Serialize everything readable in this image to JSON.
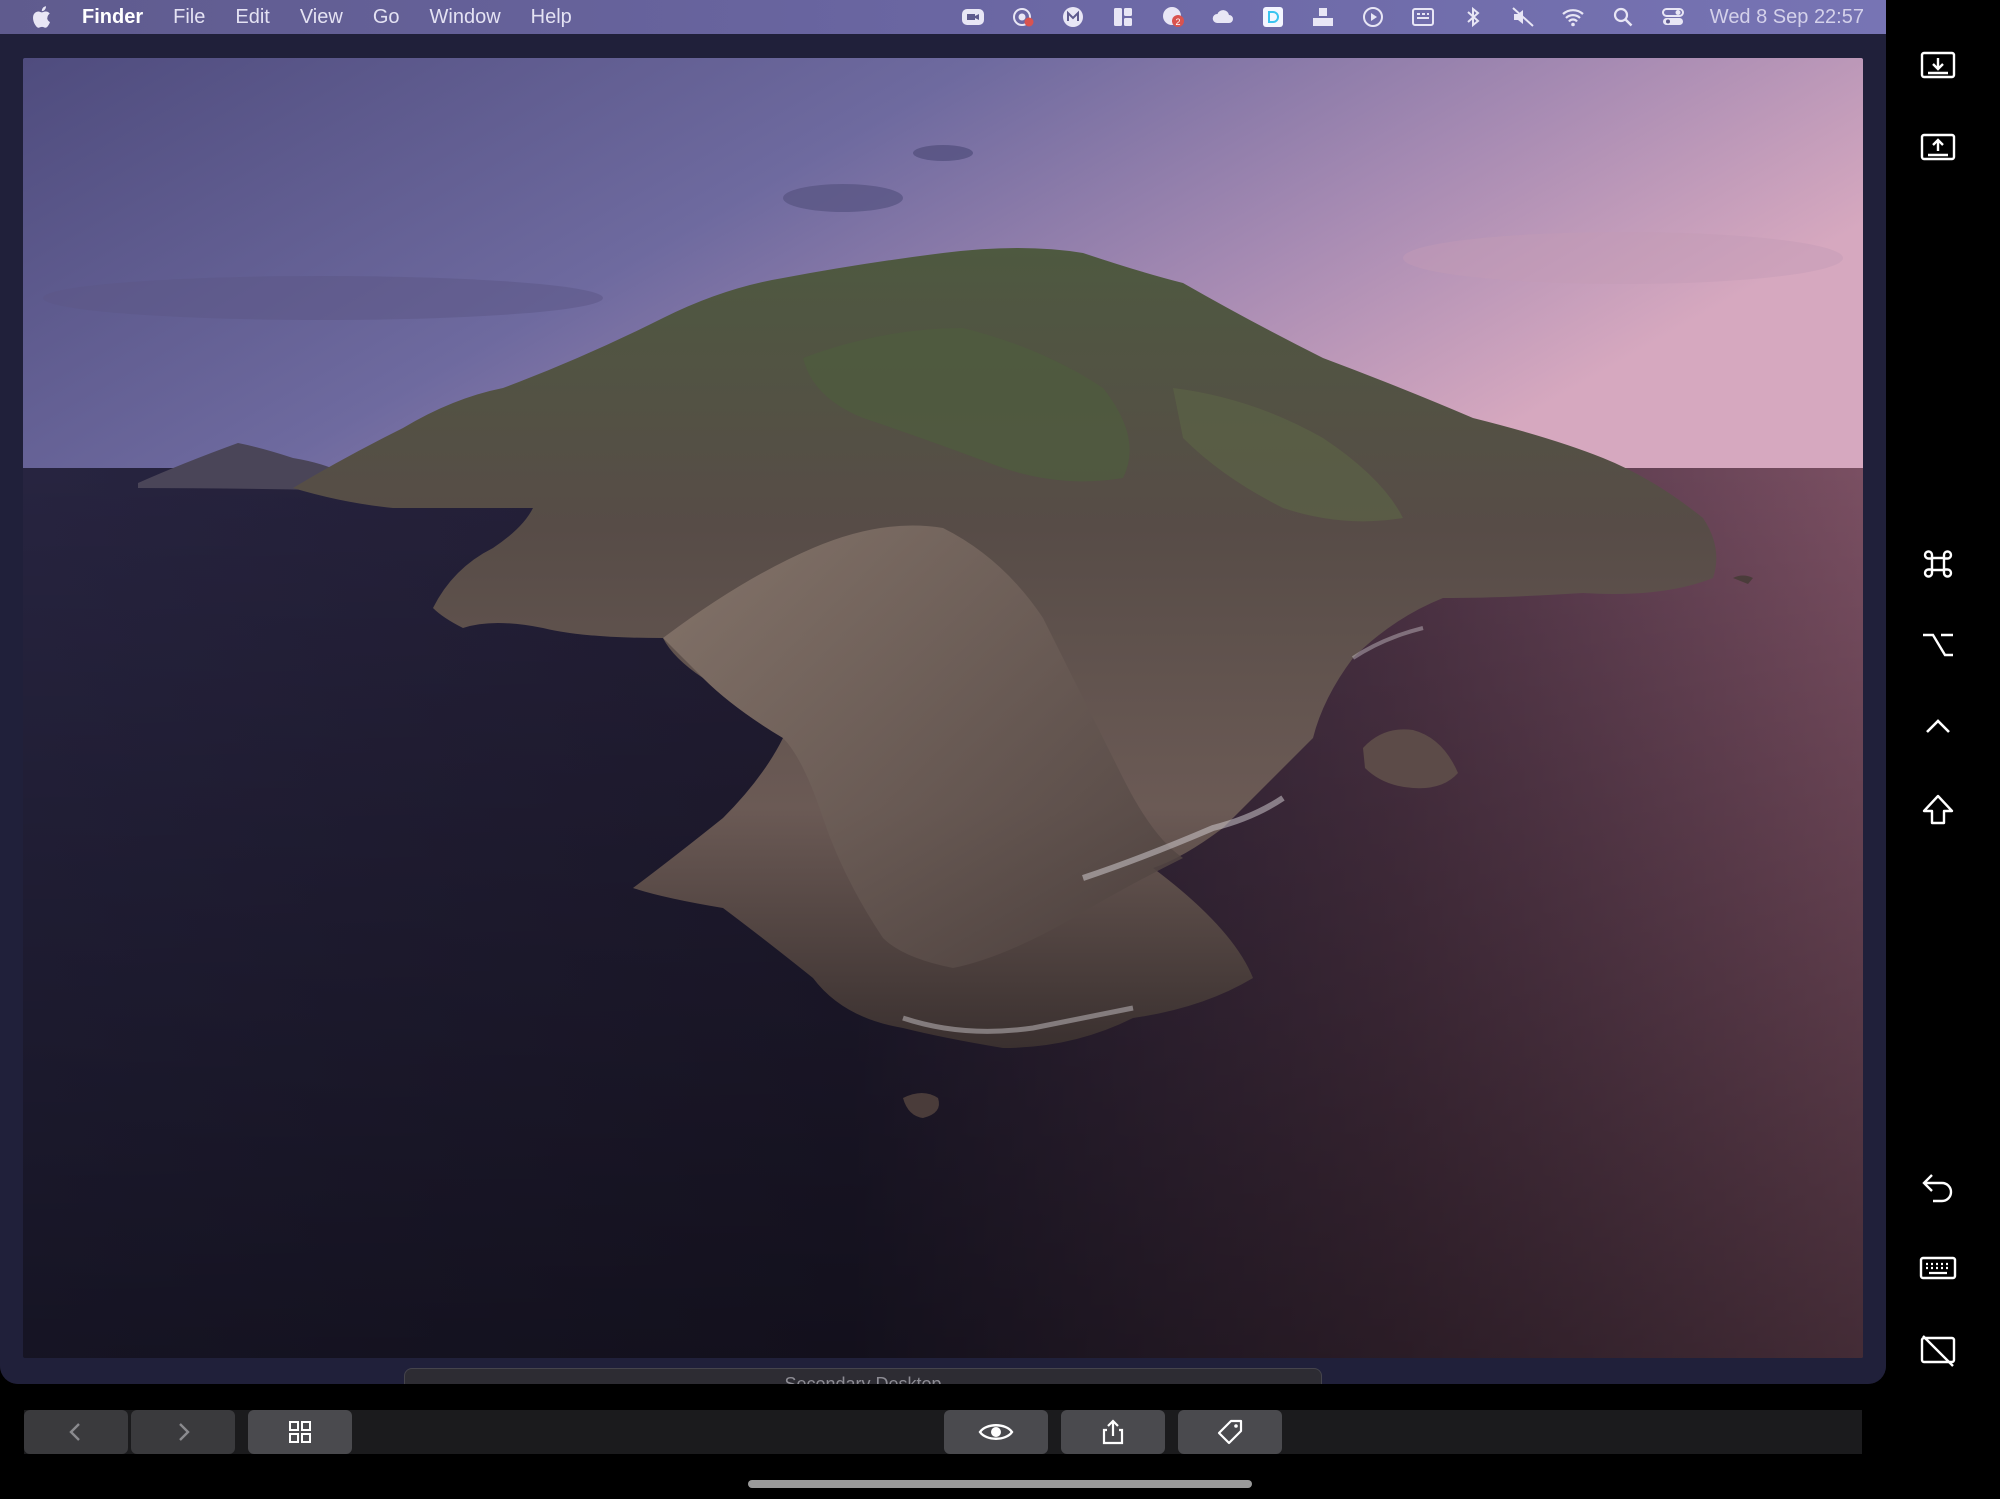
{
  "menubar": {
    "app_name": "Finder",
    "items": [
      "File",
      "Edit",
      "View",
      "Go",
      "Window",
      "Help"
    ],
    "clock": "Wed 8 Sep  22:57",
    "status_icons": [
      "zoom-icon",
      "screen-record-icon",
      "m-app-icon",
      "layout-icon",
      "notification-badge-icon",
      "cloud-icon",
      "d-app-icon",
      "dock-share-icon",
      "play-icon",
      "keyboard-icon",
      "bluetooth-icon",
      "mute-icon",
      "wifi-icon",
      "search-icon",
      "control-center-icon"
    ],
    "badge_count": "2"
  },
  "space": {
    "label": "Secondary Desktop"
  },
  "sidebar": {
    "buttons": [
      "download-screen-icon",
      "upload-screen-icon",
      "command-key-icon",
      "option-key-icon",
      "control-key-icon",
      "shift-key-icon",
      "undo-icon",
      "keyboard-icon",
      "disconnect-display-icon"
    ]
  },
  "touchbar": {
    "buttons": [
      "back-icon",
      "forward-icon",
      "grid-view-icon",
      "quick-look-icon",
      "share-icon",
      "tag-icon"
    ]
  },
  "colors": {
    "menubar": "#6a66a2",
    "touchbar_button": "#4a4a4e",
    "sea": "#2a2740"
  }
}
